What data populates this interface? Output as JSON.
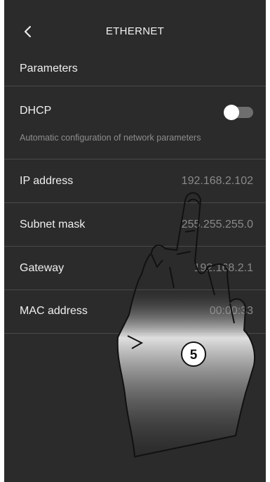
{
  "header": {
    "title": "ETHERNET",
    "back_icon": "chevron-left-icon"
  },
  "section": {
    "label": "Parameters"
  },
  "dhcp": {
    "label": "DHCP",
    "description": "Automatic configuration of network parameters",
    "enabled": false
  },
  "rows": [
    {
      "label": "IP address",
      "value": "192.168.2.102"
    },
    {
      "label": "Subnet mask",
      "value": "255.255.255.0"
    },
    {
      "label": "Gateway",
      "value": "192.168.2.1"
    },
    {
      "label": "MAC address",
      "value": "00:00:33"
    }
  ],
  "callout": {
    "number": "5"
  },
  "colors": {
    "background": "#2b2b2b",
    "divider": "#4a4a4a",
    "text": "#f0f0f0",
    "muted": "#8a8a8a"
  }
}
